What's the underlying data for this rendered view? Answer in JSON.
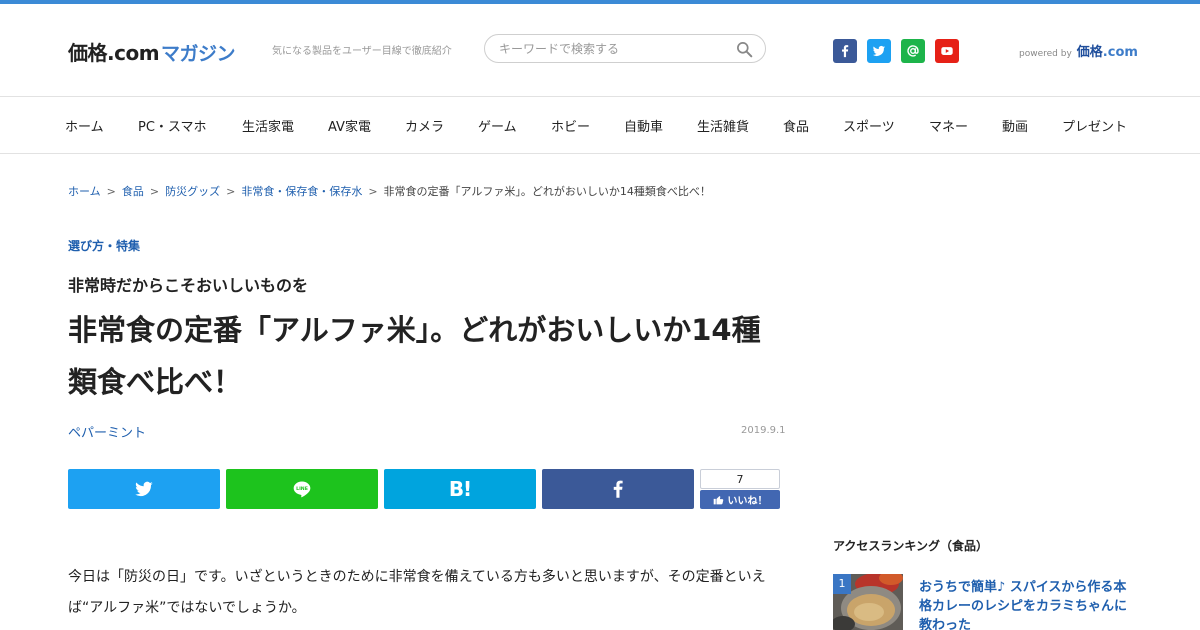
{
  "header": {
    "logo_main": "価格.com",
    "logo_sub": "マガジン",
    "tagline": "気になる製品をユーザー目線で徹底紹介",
    "search_placeholder": "キーワードで検索する",
    "powered_by": "powered by",
    "powered_logo_a": "価格",
    "powered_logo_b": ".com",
    "social": [
      {
        "name": "facebook",
        "icon": "facebook-icon",
        "color": "#3b5998"
      },
      {
        "name": "twitter",
        "icon": "twitter-icon",
        "color": "#1da1f2"
      },
      {
        "name": "mail",
        "icon": "at-icon",
        "color": "#1db44a"
      },
      {
        "name": "youtube",
        "icon": "youtube-icon",
        "color": "#e62117"
      }
    ]
  },
  "nav": {
    "items": [
      "ホーム",
      "PC・スマホ",
      "生活家電",
      "AV家電",
      "カメラ",
      "ゲーム",
      "ホビー",
      "自動車",
      "生活雑貨",
      "食品",
      "スポーツ",
      "マネー",
      "動画",
      "プレゼント"
    ]
  },
  "breadcrumb": {
    "items": [
      "ホーム",
      "食品",
      "防災グッズ",
      "非常食・保存食・保存水"
    ],
    "separator": ">",
    "current": "非常食の定番「アルファ米」。どれがおいしいか14種類食べ比べ！"
  },
  "article": {
    "category": "選び方・特集",
    "subtitle": "非常時だからこそおいしいものを",
    "title": "非常食の定番「アルファ米」。どれがおいしいか14種類食べ比べ！",
    "author": "ペパーミント",
    "date": "2019.9.1",
    "body": "今日は「防災の日」です。いざというときのために非常食を備えている方も多いと思いますが、その定番といえば“アルファ米”ではないでしょうか。"
  },
  "share": {
    "buttons": [
      {
        "name": "twitter",
        "icon": "twitter-icon",
        "color": "#1da1f2"
      },
      {
        "name": "line",
        "icon": "line-icon",
        "color": "#1dc31d"
      },
      {
        "name": "hatena",
        "icon": "hatena-icon",
        "color": "#00a4de",
        "label": "B!"
      },
      {
        "name": "facebook",
        "icon": "facebook-icon",
        "color": "#3b5998"
      }
    ],
    "like_count": "7",
    "like_label": "いいね！"
  },
  "sidebar": {
    "ranking_title": "アクセスランキング（食品）",
    "ranking": [
      {
        "rank": "1",
        "title": "おうちで簡単♪ スパイスから作る本格カレーのレシピをカラミちゃんに教わった"
      }
    ]
  }
}
